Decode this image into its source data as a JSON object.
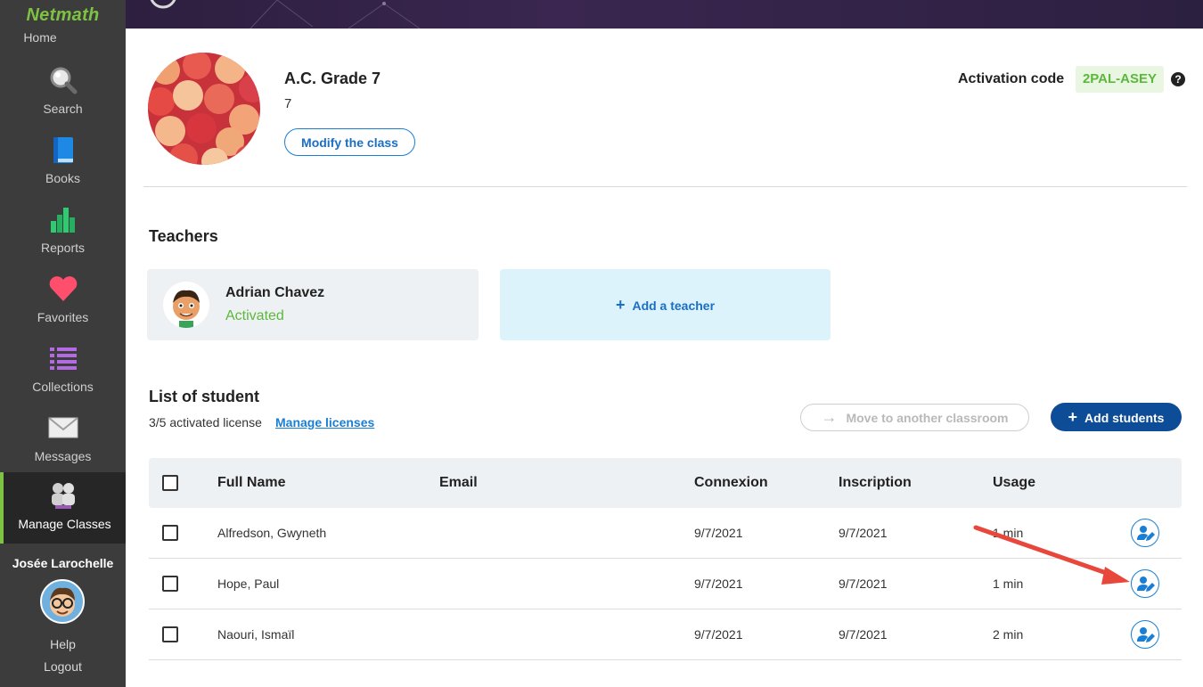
{
  "sidebar": {
    "logo": "Netmath",
    "home": "Home",
    "items": [
      {
        "label": "Search",
        "icon": "search-icon"
      },
      {
        "label": "Books",
        "icon": "book-icon"
      },
      {
        "label": "Reports",
        "icon": "bar-chart-icon"
      },
      {
        "label": "Favorites",
        "icon": "heart-icon"
      },
      {
        "label": "Collections",
        "icon": "list-icon"
      },
      {
        "label": "Messages",
        "icon": "envelope-icon"
      },
      {
        "label": "Manage Classes",
        "icon": "users-icon",
        "active": true
      }
    ],
    "user_name": "Josée Larochelle",
    "help": "Help",
    "logout": "Logout"
  },
  "class_info": {
    "title": "A.C. Grade 7",
    "subtitle": "7",
    "modify_label": "Modify the class",
    "activation_label": "Activation code",
    "activation_code": "2PAL-ASEY",
    "help_glyph": "?"
  },
  "teachers": {
    "title": "Teachers",
    "list": [
      {
        "name": "Adrian Chavez",
        "status": "Activated"
      }
    ],
    "add_label": "Add a teacher"
  },
  "students": {
    "title": "List of student",
    "license_text": "3/5 activated license",
    "manage_link": "Manage licenses",
    "move_label": "Move to another classroom",
    "add_label": "Add students",
    "columns": {
      "full_name": "Full Name",
      "email": "Email",
      "connexion": "Connexion",
      "inscription": "Inscription",
      "usage": "Usage"
    },
    "rows": [
      {
        "full_name": "Alfredson, Gwyneth",
        "email": "",
        "connexion": "9/7/2021",
        "inscription": "9/7/2021",
        "usage": "1 min"
      },
      {
        "full_name": "Hope, Paul",
        "email": "",
        "connexion": "9/7/2021",
        "inscription": "9/7/2021",
        "usage": "1 min"
      },
      {
        "full_name": "Naouri, Ismaïl",
        "email": "",
        "connexion": "9/7/2021",
        "inscription": "9/7/2021",
        "usage": "2 min"
      }
    ]
  },
  "colors": {
    "brand_green": "#7dc242",
    "primary_blue": "#0d4c96",
    "link_blue": "#1a7fd4",
    "sidebar_bg": "#3c3c3c",
    "annotation_red": "#e8473b"
  }
}
